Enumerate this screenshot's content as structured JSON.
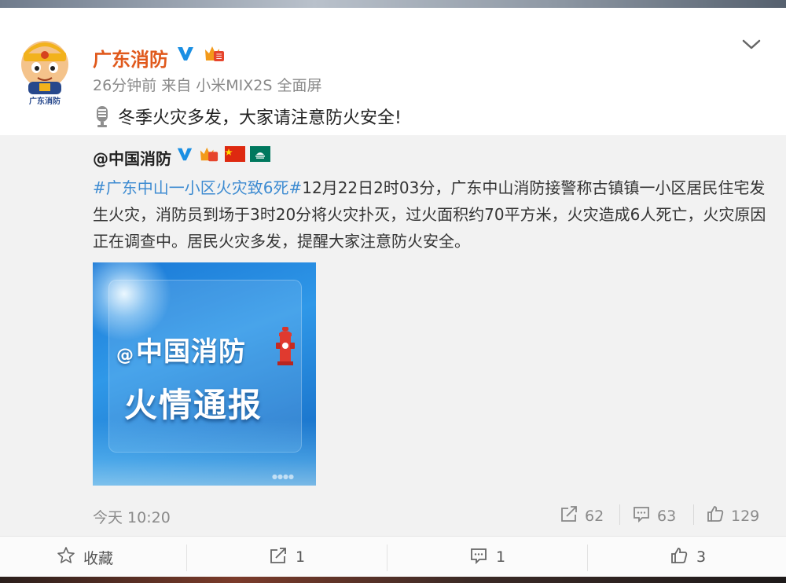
{
  "post": {
    "author": "广东消防",
    "avatar_caption": "广东消防",
    "time": "26分钟前",
    "source": "来自 小米MIX2S 全面屏",
    "text": "冬季火灾多发，大家请注意防火安全!"
  },
  "repost": {
    "author": "@中国消防",
    "hashtag": "#广东中山一小区火灾致6死#",
    "body": "12月22日2时03分，广东中山消防接警称古镇镇一小区居民住宅发生火灾，消防员到场于3时20分将火灾扑灭，过火面积约70平方米，火灾造成6人死亡，火灾原因正在调查中。居民火灾多发，提醒大家注意防火安全。",
    "image": {
      "line1_at": "@",
      "line1": "中国消防",
      "line2": "火情通报"
    },
    "time": "今天 10:20",
    "stats": {
      "reposts": "62",
      "comments": "63",
      "likes": "129"
    }
  },
  "actions": {
    "favorite": "收藏",
    "repost": "1",
    "comment": "1",
    "like": "3"
  },
  "colors": {
    "author": "#e0591c",
    "hashtag": "#3d8bd1",
    "verified": "#1a8fe3",
    "repost_bg": "#f2f2f2"
  },
  "icons": {
    "verified": "verified-v-icon",
    "level": "crown-badge-icon",
    "more": "chevron-down-icon",
    "voice": "microphone-icon",
    "repost": "share-arrow-icon",
    "comment": "comment-bubble-icon",
    "like": "thumbs-up-icon",
    "favorite": "star-outline-icon"
  }
}
